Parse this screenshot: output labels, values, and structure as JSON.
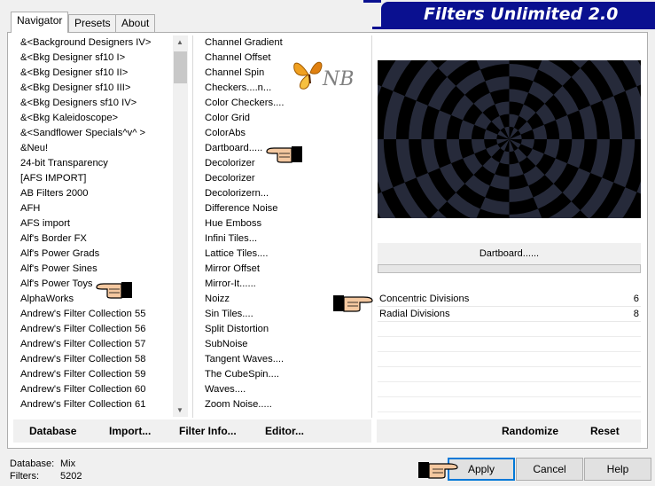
{
  "banner": {
    "title": "Filters Unlimited 2.0"
  },
  "tabs": [
    {
      "label": "Navigator",
      "active": true
    },
    {
      "label": "Presets",
      "active": false
    },
    {
      "label": "About",
      "active": false
    }
  ],
  "categories": [
    "&<Background Designers IV>",
    "&<Bkg Designer sf10 I>",
    "&<Bkg Designer sf10 II>",
    "&<Bkg Designer sf10 III>",
    "&<Bkg Designers sf10 IV>",
    "&<Bkg Kaleidoscope>",
    "&<Sandflower Specials^v^ >",
    "&Neu!",
    "24-bit Transparency",
    "[AFS IMPORT]",
    "AB Filters 2000",
    "AFH",
    "AFS import",
    "Alf's Border FX",
    "Alf's Power Grads",
    "Alf's Power Sines",
    "Alf's Power Toys",
    "AlphaWorks",
    "Andrew's Filter Collection 55",
    "Andrew's Filter Collection 56",
    "Andrew's Filter Collection 57",
    "Andrew's Filter Collection 58",
    "Andrew's Filter Collection 59",
    "Andrew's Filter Collection 60",
    "Andrew's Filter Collection 61"
  ],
  "filters": [
    "Channel Gradient",
    "Channel Offset",
    "Channel Spin",
    "Checkers....n...",
    "Color Checkers....",
    "Color Grid",
    "ColorAbs",
    "Dartboard.....",
    "Decolorizer",
    "Decolorizer",
    "Decolorizern...",
    "Difference Noise",
    "Hue Emboss",
    "Infini Tiles...",
    "Lattice Tiles....",
    "Mirror Offset",
    "Mirror-It......",
    "Noizz",
    "Sin Tiles....",
    "Split Distortion",
    "SubNoise",
    "Tangent Waves....",
    "The CubeSpin....",
    "Waves....",
    "Zoom Noise....."
  ],
  "selected_filter": "Dartboard......",
  "params": [
    {
      "label": "Concentric Divisions",
      "value": "6"
    },
    {
      "label": "Radial Divisions",
      "value": "8"
    }
  ],
  "bottom_links": {
    "database": "Database",
    "import": "Import...",
    "filter_info": "Filter Info...",
    "editor": "Editor...",
    "randomize": "Randomize",
    "reset": "Reset"
  },
  "status": {
    "database_label": "Database:",
    "database_value": "Mix",
    "filters_label": "Filters:",
    "filters_value": "5202"
  },
  "buttons": {
    "apply": "Apply",
    "cancel": "Cancel",
    "help": "Help"
  },
  "logo_text": "NB",
  "colors": {
    "banner": "#0a1090",
    "preview_bg": "#000000",
    "preview_rings": "#262a3a"
  }
}
